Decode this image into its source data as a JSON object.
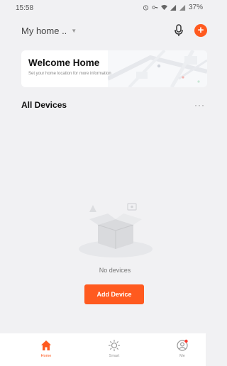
{
  "status_bar": {
    "time": "15:58",
    "battery": "37%"
  },
  "header": {
    "home_name": "My home ..",
    "caret": "▼"
  },
  "welcome_card": {
    "title": "Welcome Home",
    "subtitle": "Set your home location for more information"
  },
  "devices": {
    "section_title": "All Devices",
    "more": "···",
    "empty_text": "No devices",
    "add_button": "Add Device"
  },
  "tabbar": {
    "tabs": [
      {
        "label": "Home",
        "icon": "home-icon",
        "active": true
      },
      {
        "label": "Smart",
        "icon": "sun-icon",
        "active": false
      },
      {
        "label": "Me",
        "icon": "profile-icon",
        "active": false
      }
    ]
  },
  "colors": {
    "accent": "#ff5a1f",
    "background": "#f1f1f3",
    "card": "#ffffff"
  }
}
